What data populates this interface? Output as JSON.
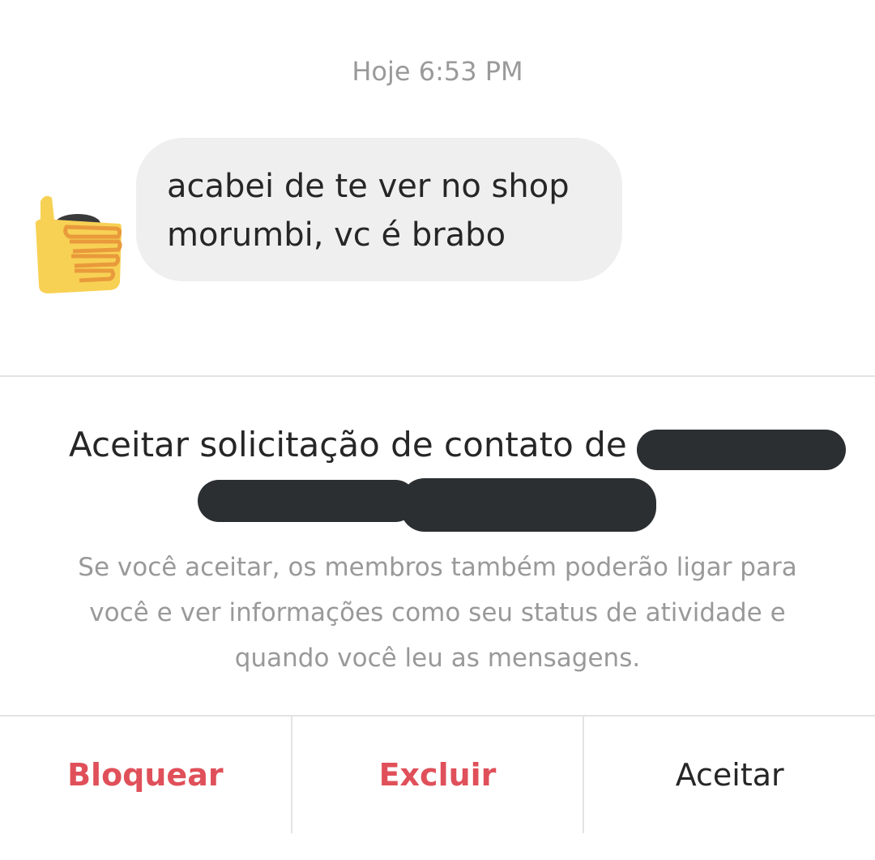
{
  "conversation": {
    "timestamp": "Hoje 6:53 PM",
    "messages": [
      {
        "sender_avatar": "thumbs-up-emoji",
        "text_line1": "acabei de te ver no shop",
        "text_line2": "morumbi, vc é brabo"
      }
    ]
  },
  "request": {
    "title": "Aceitar solicitação de contato de",
    "description_line1": "Se você aceitar, os membros também poderão ligar para",
    "description_line2": "você e ver informações como seu status de atividade e",
    "description_line3": "quando você leu as mensagens."
  },
  "actions": {
    "block_label": "Bloquear",
    "delete_label": "Excluir",
    "accept_label": "Aceitar"
  },
  "colors": {
    "danger": "#e0505a",
    "bubble_bg": "#efefef",
    "text_primary": "#262626",
    "text_secondary": "#999999",
    "redaction": "#2b2f32"
  }
}
